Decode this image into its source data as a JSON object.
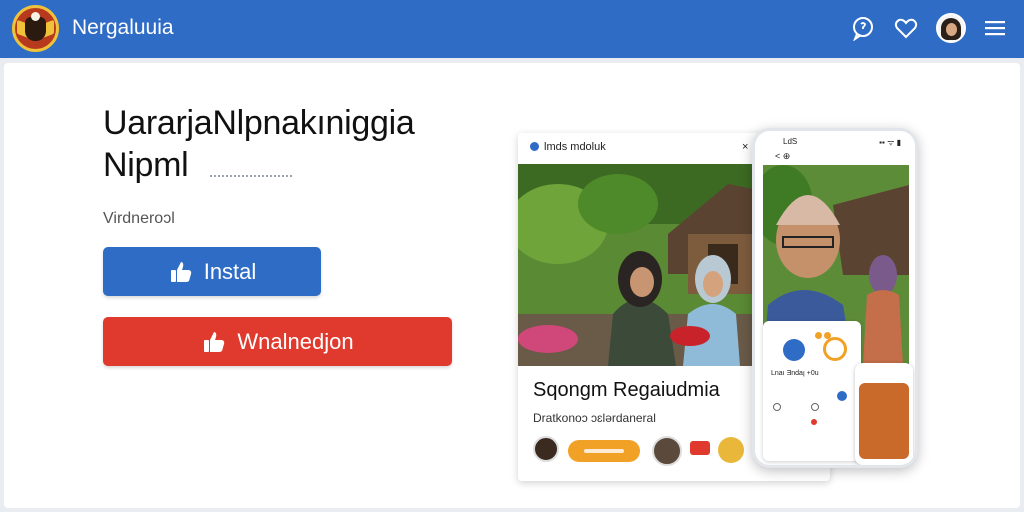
{
  "header": {
    "app_title": "Nergaluuia",
    "icons": [
      "logo-emblem-icon",
      "chat-icon",
      "heart-icon",
      "avatar",
      "menu-icon"
    ]
  },
  "hero": {
    "headline_line1": "UararjaNlpnakıniggia",
    "headline_line2": "Nipml",
    "subtitle": "Virdneroɔl",
    "install_label": "Instal",
    "download_label": "Wnalnedjon"
  },
  "preview_card": {
    "top_label": "lmds mdoluk",
    "top_close": "×",
    "title": "Sqongm Regaiudmia",
    "subtitle": "Dratkonoɔ ɔɛlǝrdaneral"
  },
  "phone": {
    "status_time": "LdS",
    "status_signal": "▪▪ ᯤ ▮",
    "nav": "< ⊕",
    "info_text": "Lnaı Ǝndaꞁ\n+0u"
  },
  "colors": {
    "primary": "#2f6cc6",
    "danger": "#e03a2e",
    "accent": "#f2a127",
    "background": "#e9ecf1"
  }
}
